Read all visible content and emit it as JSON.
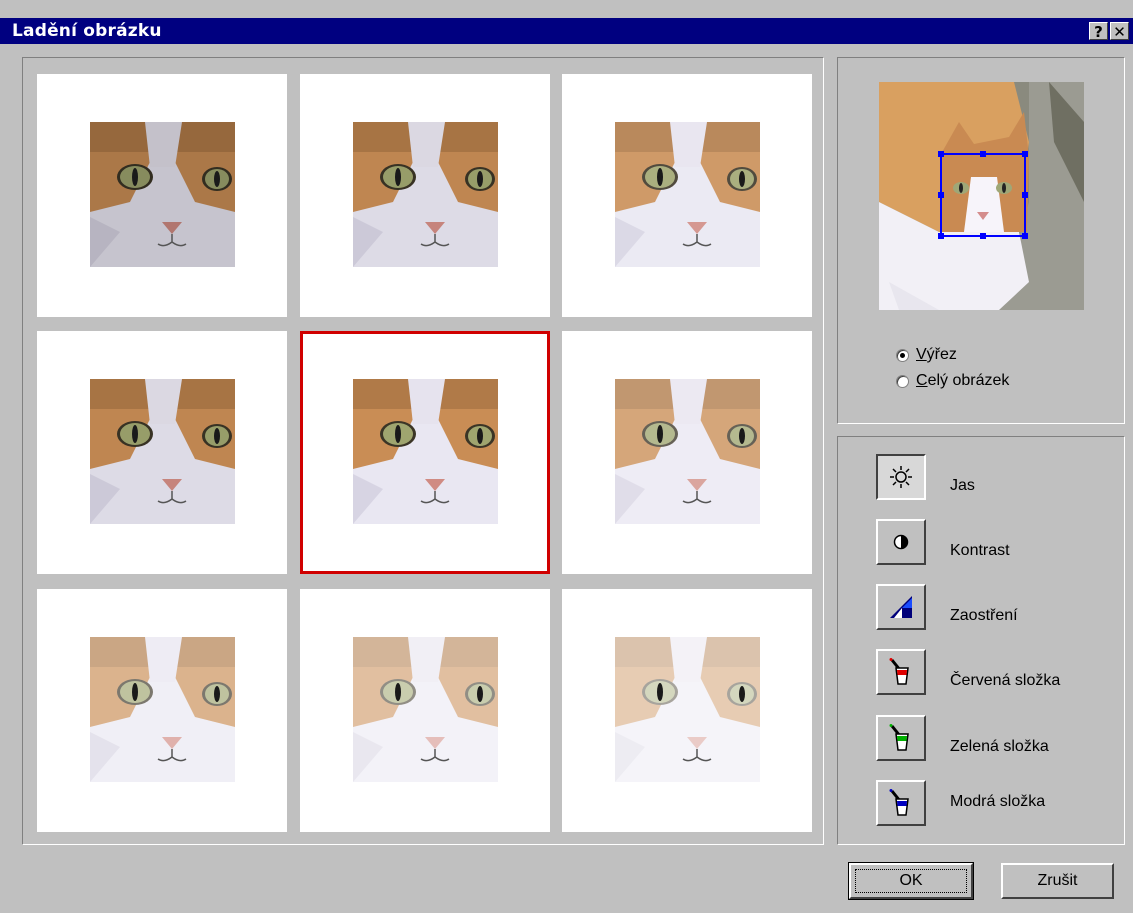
{
  "window": {
    "title": "Ladění obrázku",
    "help_label": "?",
    "close_label": "✕"
  },
  "variants": {
    "count": 9,
    "selected_index": 4,
    "brightness": [
      0.85,
      0.95,
      1.05,
      0.95,
      1.0,
      1.1,
      1.15,
      1.2,
      1.25
    ]
  },
  "preview": {
    "options": [
      {
        "access": "V",
        "rest": "ýřez",
        "checked": true
      },
      {
        "access": "C",
        "rest": "elý obrázek",
        "checked": false
      }
    ]
  },
  "tools": [
    {
      "label": "Jas",
      "icon": "sun-icon",
      "active": true
    },
    {
      "label": "Kontrast",
      "icon": "contrast-icon",
      "active": false
    },
    {
      "label": "Zaostření",
      "icon": "sharpen-icon",
      "active": false
    },
    {
      "label": "Červená složka",
      "icon": "red-paint-bucket-icon",
      "active": false,
      "color": "#e00000"
    },
    {
      "label": "Zelená složka",
      "icon": "green-paint-bucket-icon",
      "active": false,
      "color": "#00b000"
    },
    {
      "label": "Modrá složka",
      "icon": "blue-paint-bucket-icon",
      "active": false,
      "color": "#0000c0"
    }
  ],
  "buttons": {
    "ok": "OK",
    "cancel": "Zrušit"
  },
  "colors": {
    "titlebar": "#000080",
    "selection": "#d00000",
    "crop_frame": "#0000ff"
  }
}
